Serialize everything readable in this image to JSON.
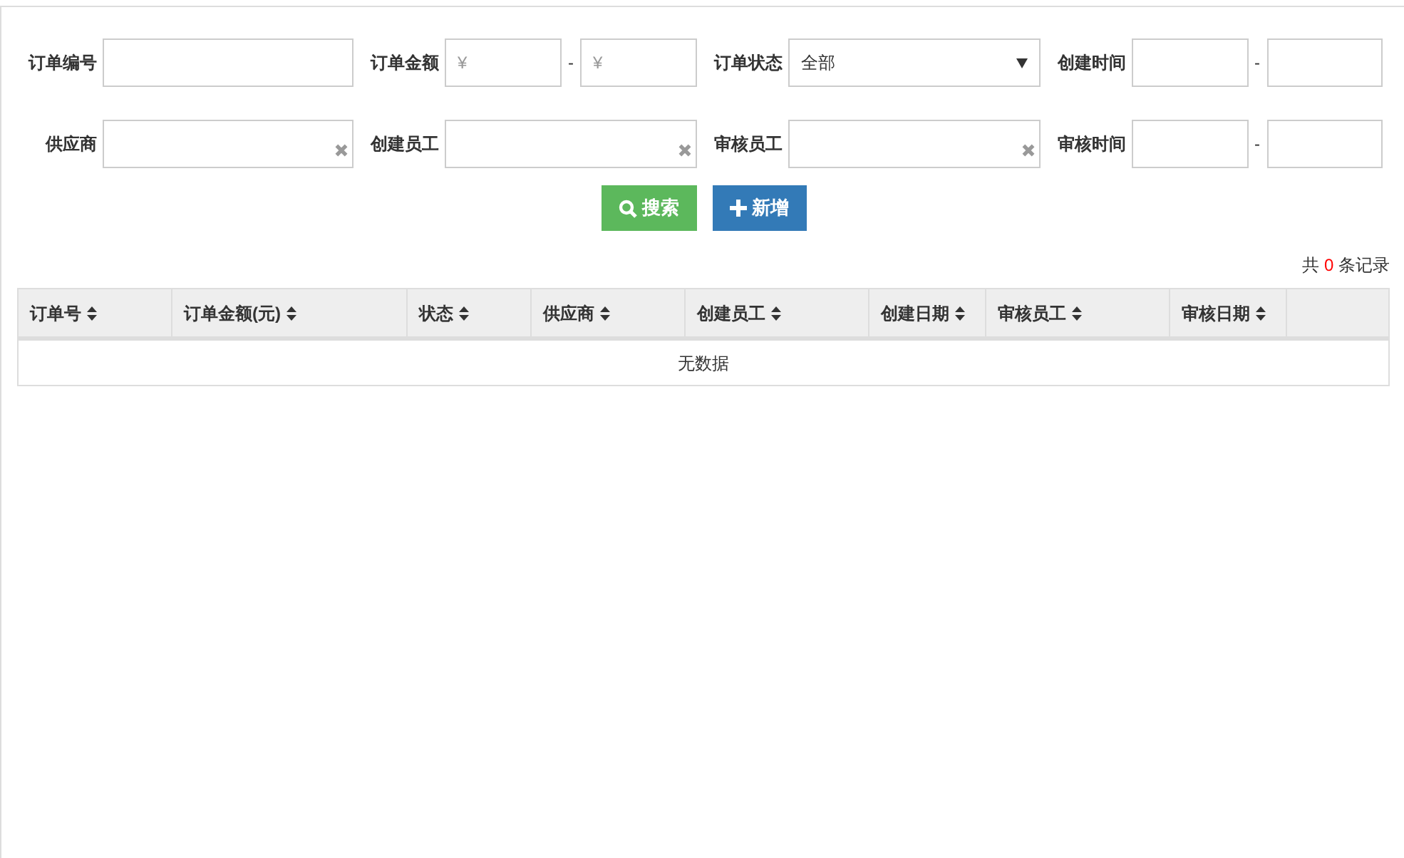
{
  "filters": [
    {
      "kind": "text",
      "label": "订单编号",
      "clearable": false
    },
    {
      "kind": "range",
      "label": "订单金额",
      "placeholders": [
        "¥",
        "¥"
      ],
      "separator": "-"
    },
    {
      "kind": "select",
      "label": "订单状态",
      "value": "全部"
    },
    {
      "kind": "range",
      "label": "创建时间",
      "separator": "-"
    },
    {
      "kind": "text",
      "label": "供应商",
      "clearable": true
    },
    {
      "kind": "text",
      "label": "创建员工",
      "clearable": true
    },
    {
      "kind": "text",
      "label": "审核员工",
      "clearable": true
    },
    {
      "kind": "range",
      "label": "审核时间",
      "separator": "-"
    }
  ],
  "buttons": [
    {
      "label": "搜索",
      "kind": "search"
    },
    {
      "label": "新增",
      "kind": "add"
    }
  ],
  "record_count": {
    "prefix": "共",
    "count": "0",
    "suffix": "条记录"
  },
  "table": {
    "columns": [
      "订单号",
      "订单金额(元)",
      "状态",
      "供应商",
      "创建员工",
      "创建日期",
      "审核员工",
      "审核日期",
      ""
    ],
    "empty_text": "无数据"
  }
}
